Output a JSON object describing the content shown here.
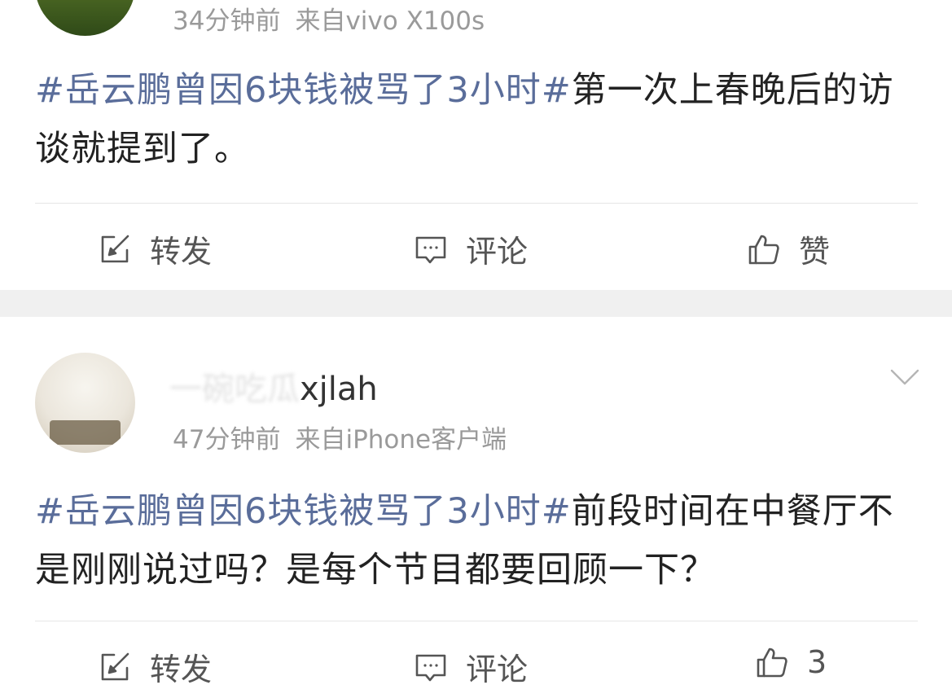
{
  "posts": [
    {
      "nickname": "",
      "time": "34分钟前",
      "source": "来自vivo X100s",
      "topic": "#岳云鹏曾因6块钱被骂了3小时#",
      "text": "第一次上春晚后的访谈就提到了。",
      "actions": {
        "repost": "转发",
        "comment": "评论",
        "like": "赞"
      }
    },
    {
      "nickname_hidden": "一碗吃瓜",
      "nickname_visible": "xjlah",
      "time": "47分钟前",
      "source": "来自iPhone客户端",
      "topic": "#岳云鹏曾因6块钱被骂了3小时#",
      "text": "前段时间在中餐厅不是刚刚说过吗？是每个节目都要回顾一下？",
      "actions": {
        "repost": "转发",
        "comment": "评论",
        "like": "3"
      }
    }
  ],
  "colors": {
    "topic": "#5a6d9a",
    "meta": "#9a9a9a",
    "separator": "#f0f0f0"
  },
  "icons": [
    "repost-icon",
    "comment-icon",
    "like-icon",
    "chevron-down-icon"
  ]
}
